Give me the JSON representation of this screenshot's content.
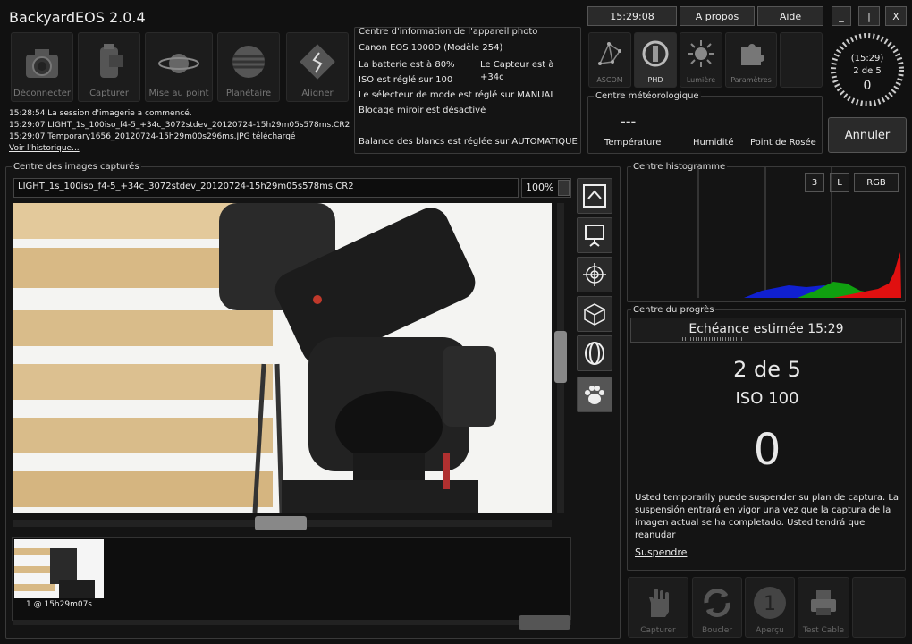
{
  "app": {
    "title": "BackyardEOS 2.0.4"
  },
  "toolbar": {
    "items": [
      {
        "label": "Déconnecter",
        "icon": "camera-icon"
      },
      {
        "label": "Capturer",
        "icon": "film-roll-icon"
      },
      {
        "label": "Mise au point",
        "icon": "planet-icon"
      },
      {
        "label": "Planétaire",
        "icon": "jupiter-icon"
      },
      {
        "label": "Aligner",
        "icon": "align-icon"
      }
    ]
  },
  "log": {
    "lines": [
      "15:28:54  La session d'imagerie a commencé.",
      "15:29:07  LIGHT_1s_100iso_f4-5_+34c_3072stdev_20120724-15h29m05s578ms.CR2 téléchargé",
      "15:29:07  Temporary1656_20120724-15h29m00s296ms.JPG téléchargé"
    ],
    "history_link": "Voir l'historique..."
  },
  "camera_info": {
    "title": "Centre d'information de l'appareil photo",
    "model": "Canon EOS 1000D   (Modèle 254)",
    "battery": "La batterie est à 80%",
    "sensor": "Le Capteur est à +34c",
    "iso": "ISO est réglé sur 100",
    "mode": "Le sélecteur de mode est réglé sur MANUAL",
    "mirror": "Blocage miroir est désactivé",
    "wb": "Balance des blancs est réglée sur AUTOMATIQUE"
  },
  "topbar": {
    "time": "15:29:08",
    "about": "A propos",
    "help": "Aide",
    "minimize": "_",
    "maximize": "|",
    "close": "X"
  },
  "plugins": [
    {
      "label": "ASCOM",
      "icon": "ascom-icon"
    },
    {
      "label": "PHD",
      "icon": "phd-icon"
    },
    {
      "label": "Lumière",
      "icon": "sun-icon"
    },
    {
      "label": "Paramètres",
      "icon": "puzzle-icon"
    }
  ],
  "weather": {
    "title": "Centre météorologique",
    "value": "---",
    "temperature": "Température",
    "humidity": "Humidité",
    "dew_point": "Point de Rosée"
  },
  "dial": {
    "time": "(15:29)",
    "progress": "2 de 5",
    "count": "0"
  },
  "cancel_button": "Annuler",
  "images": {
    "title": "Centre des images capturés",
    "filename": "LIGHT_1s_100iso_f4-5_+34c_3072stdev_20120724-15h29m05s578ms.CR2",
    "zoom": "100%",
    "thumb_label": "1 @ 15h29m07s"
  },
  "histogram": {
    "title": "Centre histogramme",
    "btn_3": "3",
    "btn_l": "L",
    "btn_rgb": "RGB",
    "colors": {
      "red": "#e01010",
      "green": "#10a010",
      "blue": "#1020d0"
    }
  },
  "progress": {
    "title": "Centre du progrès",
    "eta": "Echéance estimée 15:29",
    "frame": "2 de 5",
    "iso": "ISO 100",
    "count": "0",
    "message": "Usted temporarily puede suspender su plan de captura. La suspensión entrará en vigor una vez que la captura de la imagen actual se ha completado. Usted tendrá que reanudar",
    "suspend": "Suspendre"
  },
  "bottom_buttons": [
    {
      "label": "Capturer",
      "icon": "hand-icon"
    },
    {
      "label": "Boucler",
      "icon": "loop-icon"
    },
    {
      "label": "Aperçu",
      "icon": "preview-one-icon"
    },
    {
      "label": "Test Cable",
      "icon": "printer-icon"
    }
  ]
}
